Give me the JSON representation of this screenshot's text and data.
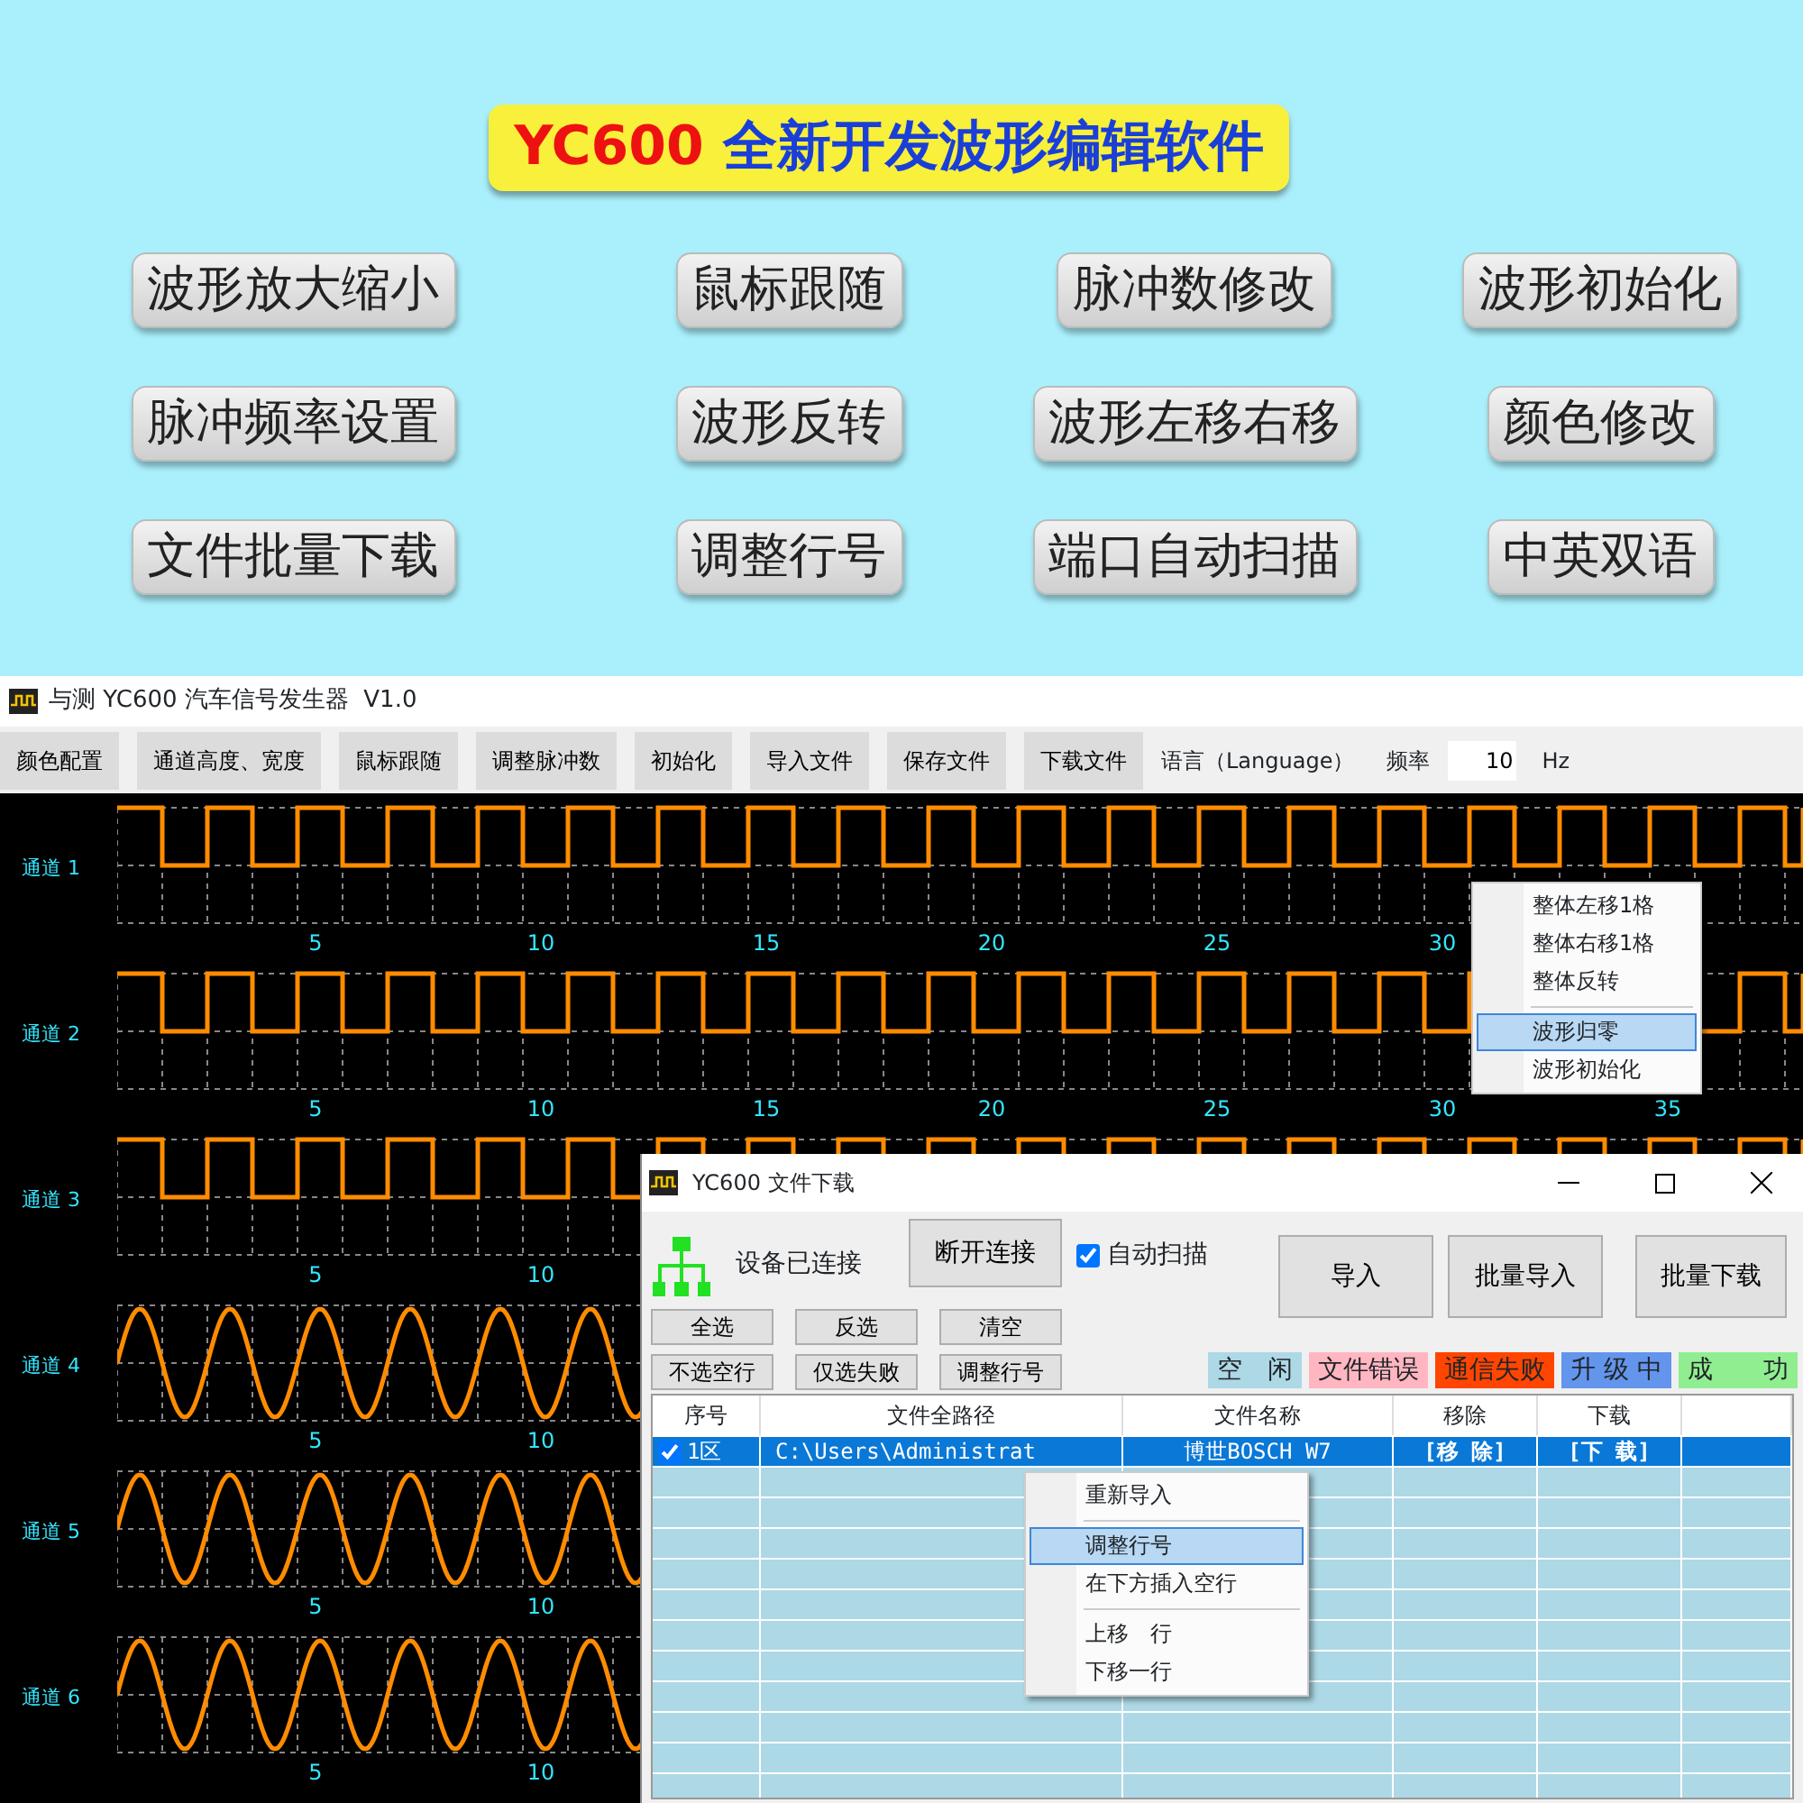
{
  "banner": {
    "title": {
      "code": "YC600",
      "text": "全新开发波形编辑软件"
    },
    "features": [
      "波形放大缩小",
      "鼠标跟随",
      "脉冲数修改",
      "波形初始化",
      "脉冲频率设置",
      "波形反转",
      "波形左移右移",
      "颜色修改",
      "文件批量下载",
      "调整行号",
      "端口自动扫描",
      "中英双语"
    ]
  },
  "window": {
    "title": "与测 YC600 汽车信号发生器  V1.0",
    "toolbar": [
      "颜色配置",
      "通道高度、宽度",
      "鼠标跟随",
      "调整脉冲数",
      "初始化",
      "导入文件",
      "保存文件",
      "下载文件"
    ],
    "language_label": "语言（Language）",
    "frequency_label": "频率",
    "frequency_value": "10",
    "frequency_unit": "Hz"
  },
  "channels": [
    {
      "label": "通道 1",
      "kind": "square",
      "ticks": [
        "5",
        "10",
        "15",
        "20",
        "25",
        "30"
      ]
    },
    {
      "label": "通道 2",
      "kind": "square",
      "ticks": [
        "5",
        "10",
        "15",
        "20",
        "25",
        "30",
        "35"
      ]
    },
    {
      "label": "通道 3",
      "kind": "square",
      "ticks": [
        "5",
        "10"
      ]
    },
    {
      "label": "通道 4",
      "kind": "sine",
      "ticks": [
        "5",
        "10"
      ]
    },
    {
      "label": "通道 5",
      "kind": "sine",
      "ticks": [
        "5",
        "10"
      ]
    },
    {
      "label": "通道 6",
      "kind": "sine",
      "ticks": [
        "5",
        "10"
      ]
    }
  ],
  "wave_menu": [
    {
      "label": "整体左移1格",
      "selected": false,
      "separator_before": false
    },
    {
      "label": "整体右移1格",
      "selected": false,
      "separator_before": false
    },
    {
      "label": "整体反转",
      "selected": false,
      "separator_before": false
    },
    {
      "label": "波形归零",
      "selected": true,
      "separator_before": true
    },
    {
      "label": "波形初始化",
      "selected": false,
      "separator_before": false
    }
  ],
  "dialog": {
    "title": "YC600 文件下载",
    "status": "设备已连接",
    "disconnect_button": "断开连接",
    "auto_scan": {
      "label": "自动扫描",
      "checked": true
    },
    "big_buttons": [
      "导入",
      "批量导入",
      "批量下载"
    ],
    "small_buttons": [
      "全选",
      "反选",
      "清空",
      "不选空行",
      "仅选失败",
      "调整行号"
    ],
    "legend": [
      {
        "label": "空　闲",
        "color": "#add8e6"
      },
      {
        "label": "文件错误",
        "color": "#ffb6c1"
      },
      {
        "label": "通信失败",
        "color": "#ff4500"
      },
      {
        "label": "升 级 中",
        "color": "#6495ed"
      },
      {
        "label": "成　　功",
        "color": "#90ee90"
      }
    ],
    "table": {
      "columns": [
        "序号",
        "文件全路径",
        "文件名称",
        "移除",
        "下载"
      ],
      "rows": [
        {
          "checked": true,
          "selected": true,
          "index": "1区",
          "path": "C:\\Users\\Administrat",
          "name": "博世BOSCH W7",
          "remove": "[移 除]",
          "download": "[下 载]"
        }
      ]
    },
    "row_menu": [
      {
        "label": "重新导入",
        "selected": false,
        "separator_before": false
      },
      {
        "label": "调整行号",
        "selected": true,
        "separator_before": true
      },
      {
        "label": "在下方插入空行",
        "selected": false,
        "separator_before": false
      },
      {
        "label": "上移　行",
        "selected": false,
        "separator_before": true
      },
      {
        "label": "下移一行",
        "selected": false,
        "separator_before": false
      }
    ]
  }
}
